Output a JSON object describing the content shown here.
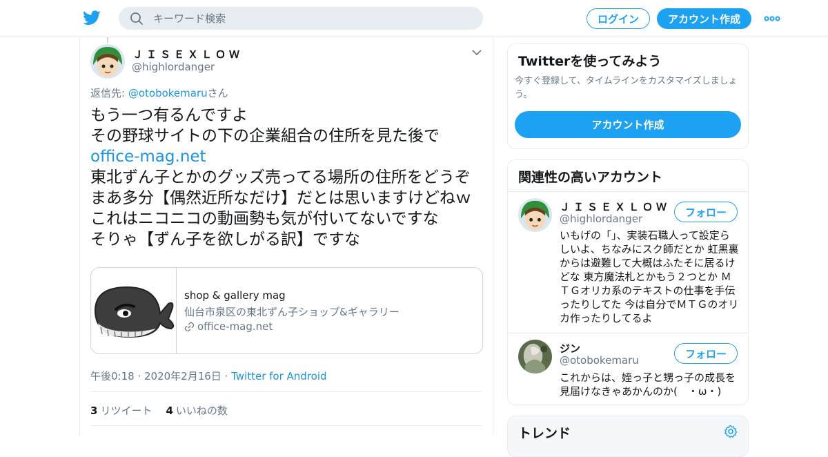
{
  "header": {
    "search_placeholder": "キーワード検索",
    "login_label": "ログイン",
    "signup_label": "アカウント作成"
  },
  "tweet": {
    "author_name": "ＪＩＳＥＸＬＯＷ",
    "author_handle": "@highlordanger",
    "reply_prefix": "返信先: ",
    "reply_mention": "@otobokemaru",
    "reply_suffix": "さん",
    "lines": [
      "もう一つ有るんですよ",
      "その野球サイトの下の企業組合の住所を見た後で",
      "office-mag.net",
      "東北ずん子とかのグッズ売ってる場所の住所をどうぞ",
      "まあ多分【偶然近所なだけ】だとは思いますけどねｗ",
      "これはニコニコの動画勢も気が付いてないですな",
      "そりゃ【ずん子を欲しがる訳】ですな"
    ],
    "card": {
      "title": "shop & gallery mag",
      "description": "仙台市泉区の東北ずん子ショップ&ギャラリー",
      "url": "office-mag.net"
    },
    "meta_time": "午後0:18 · 2020年2月16日 · ",
    "meta_source": "Twitter for Android",
    "retweet_count": "3",
    "retweet_label": "リツイート",
    "like_count": "4",
    "like_label": "いいねの数"
  },
  "signup_module": {
    "title": "Twitterを使ってみよう",
    "description": "今すぐ登録して、タイムラインをカスタマイズしましょう。",
    "button_label": "アカウント作成"
  },
  "related_module": {
    "title": "関連性の高いアカウント",
    "accounts": [
      {
        "name": "ＪＩＳＥＸＬＯＷ",
        "handle": "@highlordanger",
        "follow_label": "フォロー",
        "bio_lines": [
          "いもげの「」、実装石職人って設定ら",
          "しいよ、ちなみにスク師だとか 虹黒裏",
          "からは避難して大概はふたそに居るけ",
          "どな 東方魔法札とかもう２つとか Ｍ",
          "ＴＧオリカ系のテキストの仕事を手伝",
          "ったりしてた 今は自分でＭＴＧのオリ",
          "カ作ったりしてるよ"
        ]
      },
      {
        "name": "ジン",
        "handle": "@otobokemaru",
        "follow_label": "フォロー",
        "bio_lines": [
          "これからは、姪っ子と甥っ子の成長を",
          "見届けなきゃあかんのか(　・ω・)"
        ]
      }
    ]
  },
  "trends_module": {
    "title": "トレンド"
  },
  "colors": {
    "brand": "#1da1f2",
    "link": "#1b95e0",
    "secondary_text": "#657786"
  }
}
